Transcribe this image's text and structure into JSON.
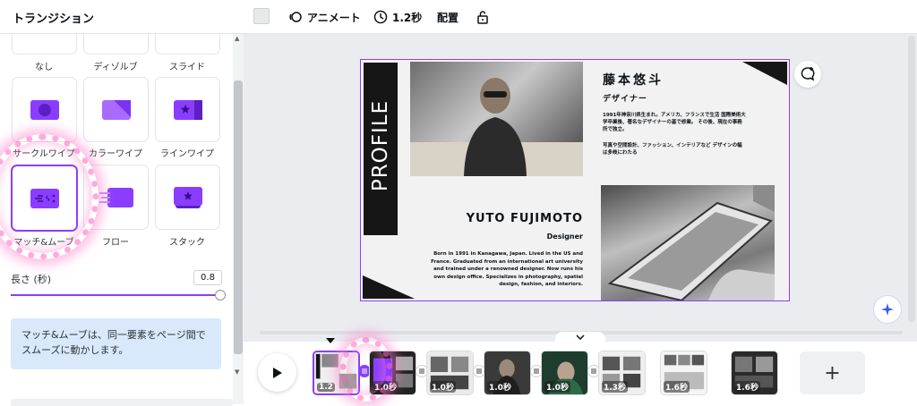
{
  "panel": {
    "title": "トランジション",
    "tiles": [
      {
        "label": "なし",
        "icon": "none-icon"
      },
      {
        "label": "ディゾルブ",
        "icon": "dissolve-icon"
      },
      {
        "label": "スライド",
        "icon": "slide-icon"
      },
      {
        "label": "サークルワイプ",
        "icon": "circle-wipe-icon"
      },
      {
        "label": "カラーワイプ",
        "icon": "color-wipe-icon"
      },
      {
        "label": "ラインワイプ",
        "icon": "line-wipe-icon"
      },
      {
        "label": "マッチ&ムーブ",
        "icon": "match-move-icon",
        "selected": true
      },
      {
        "label": "フロー",
        "icon": "flow-icon"
      },
      {
        "label": "スタック",
        "icon": "stack-icon"
      }
    ],
    "duration_label": "長さ (秒)",
    "duration_value": "0.8",
    "duration_fraction": 1.0,
    "info_text": "マッチ&ムーブは、同一要素をページ間でスムーズに動かします。"
  },
  "toolbar": {
    "animate_label": "アニメート",
    "time_label": "1.2秒",
    "arrange_label": "配置"
  },
  "slide": {
    "profile_text": "PROFILE",
    "jp_name": "藤本悠斗",
    "jp_role": "デザイナー",
    "jp_bio1": "1991年神奈川県生まれ。アメリカ、フランスで生活 国際美術大学卒業後、著名なデザイナーの基で修業。 その後、現在の事務所で独立。",
    "jp_bio2": "写真や空間設計、ファッション、インテリアなど デザインの幅は多岐にわたる",
    "en_name": "YUTO FUJIMOTO",
    "en_role": "Designer",
    "en_bio": "Born in 1991 in Kanagawa, Japan. Lived in the US and France. Graduated from an international art university and trained under a renowned designer. Now runs his own design office. Specializes in photography, spatial design, fashion, and interiors."
  },
  "timeline": {
    "pages": [
      {
        "duration": "1.2",
        "selected": true
      },
      {
        "duration": "1.0秒"
      },
      {
        "duration": "1.0秒"
      },
      {
        "duration": "1.0秒"
      },
      {
        "duration": "1.0秒"
      },
      {
        "duration": "1.3秒"
      },
      {
        "duration": "1.6秒"
      },
      {
        "duration": "1.6秒"
      }
    ],
    "add_label": "+"
  },
  "colors": {
    "accent": "#8b3dff",
    "info_bg": "#d9e8fb",
    "canvas_bg": "#ebecf0"
  }
}
